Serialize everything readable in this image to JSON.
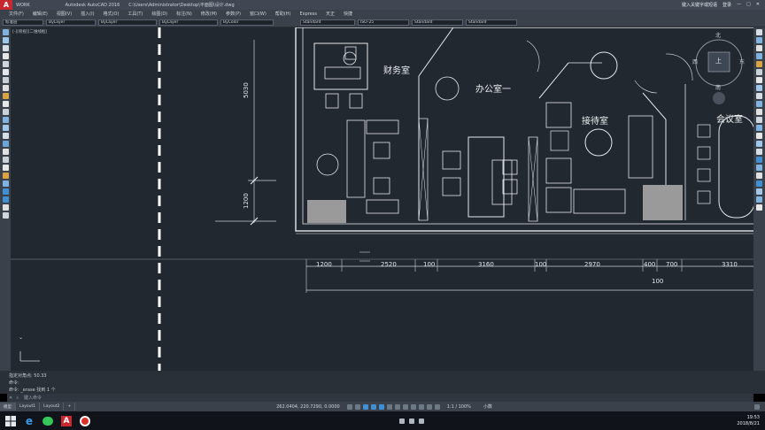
{
  "titlebar": {
    "workspace": "WORK",
    "app_title": "Autodesk AutoCAD 2016",
    "file_path": "C:\\Users\\Administrator\\Desktop\\平面图\\设计.dwg",
    "right": [
      "键入关键字或短语",
      "登录"
    ]
  },
  "menu": {
    "items": [
      "文件(F)",
      "编辑(E)",
      "视图(V)",
      "插入(I)",
      "格式(O)",
      "工具(T)",
      "绘图(D)",
      "标注(N)",
      "修改(M)",
      "参数(P)",
      "窗口(W)",
      "帮助(H)",
      "Express",
      "天正",
      "快捷"
    ]
  },
  "props": {
    "layer": "标准层",
    "color": "ByLayer",
    "linetype": "ByLayer",
    "lineweight": "ByLayer",
    "plotstyle": "ByColor",
    "textstyle": "Standard",
    "dimstyle": "ISO-25",
    "tablestyle": "Standard",
    "mleaderstyle": "Standard"
  },
  "canvas_label": "[-][俯视][二维线框]",
  "rooms": {
    "finance": "财务室",
    "office1": "办公室一",
    "reception": "接待室",
    "meeting": "会议室"
  },
  "viewcube": {
    "north": "北",
    "south": "南",
    "east": "东",
    "west": "西",
    "top": "上",
    "wcs": "WCS"
  },
  "dims": {
    "vertical": [
      "5030",
      "1200"
    ],
    "row1": [
      "1200",
      "2520",
      "100",
      "3160",
      "100",
      "2970",
      "400",
      "700",
      "3310"
    ],
    "row2": [
      "100"
    ]
  },
  "command": {
    "lines": [
      "指定对角点: 50.33",
      "命令:",
      "命令: _erase 找到 1 个"
    ],
    "placeholder": "键入命令"
  },
  "layouts": {
    "tabs": [
      "模型",
      "Layout1",
      "Layout2",
      "+"
    ]
  },
  "status": {
    "coords": "262.0404, 220.7290, 0.0000",
    "scale": "1:1 / 100%",
    "mode": "小数"
  },
  "taskbar": {
    "time": "19:53",
    "date": "2018/8/21"
  }
}
